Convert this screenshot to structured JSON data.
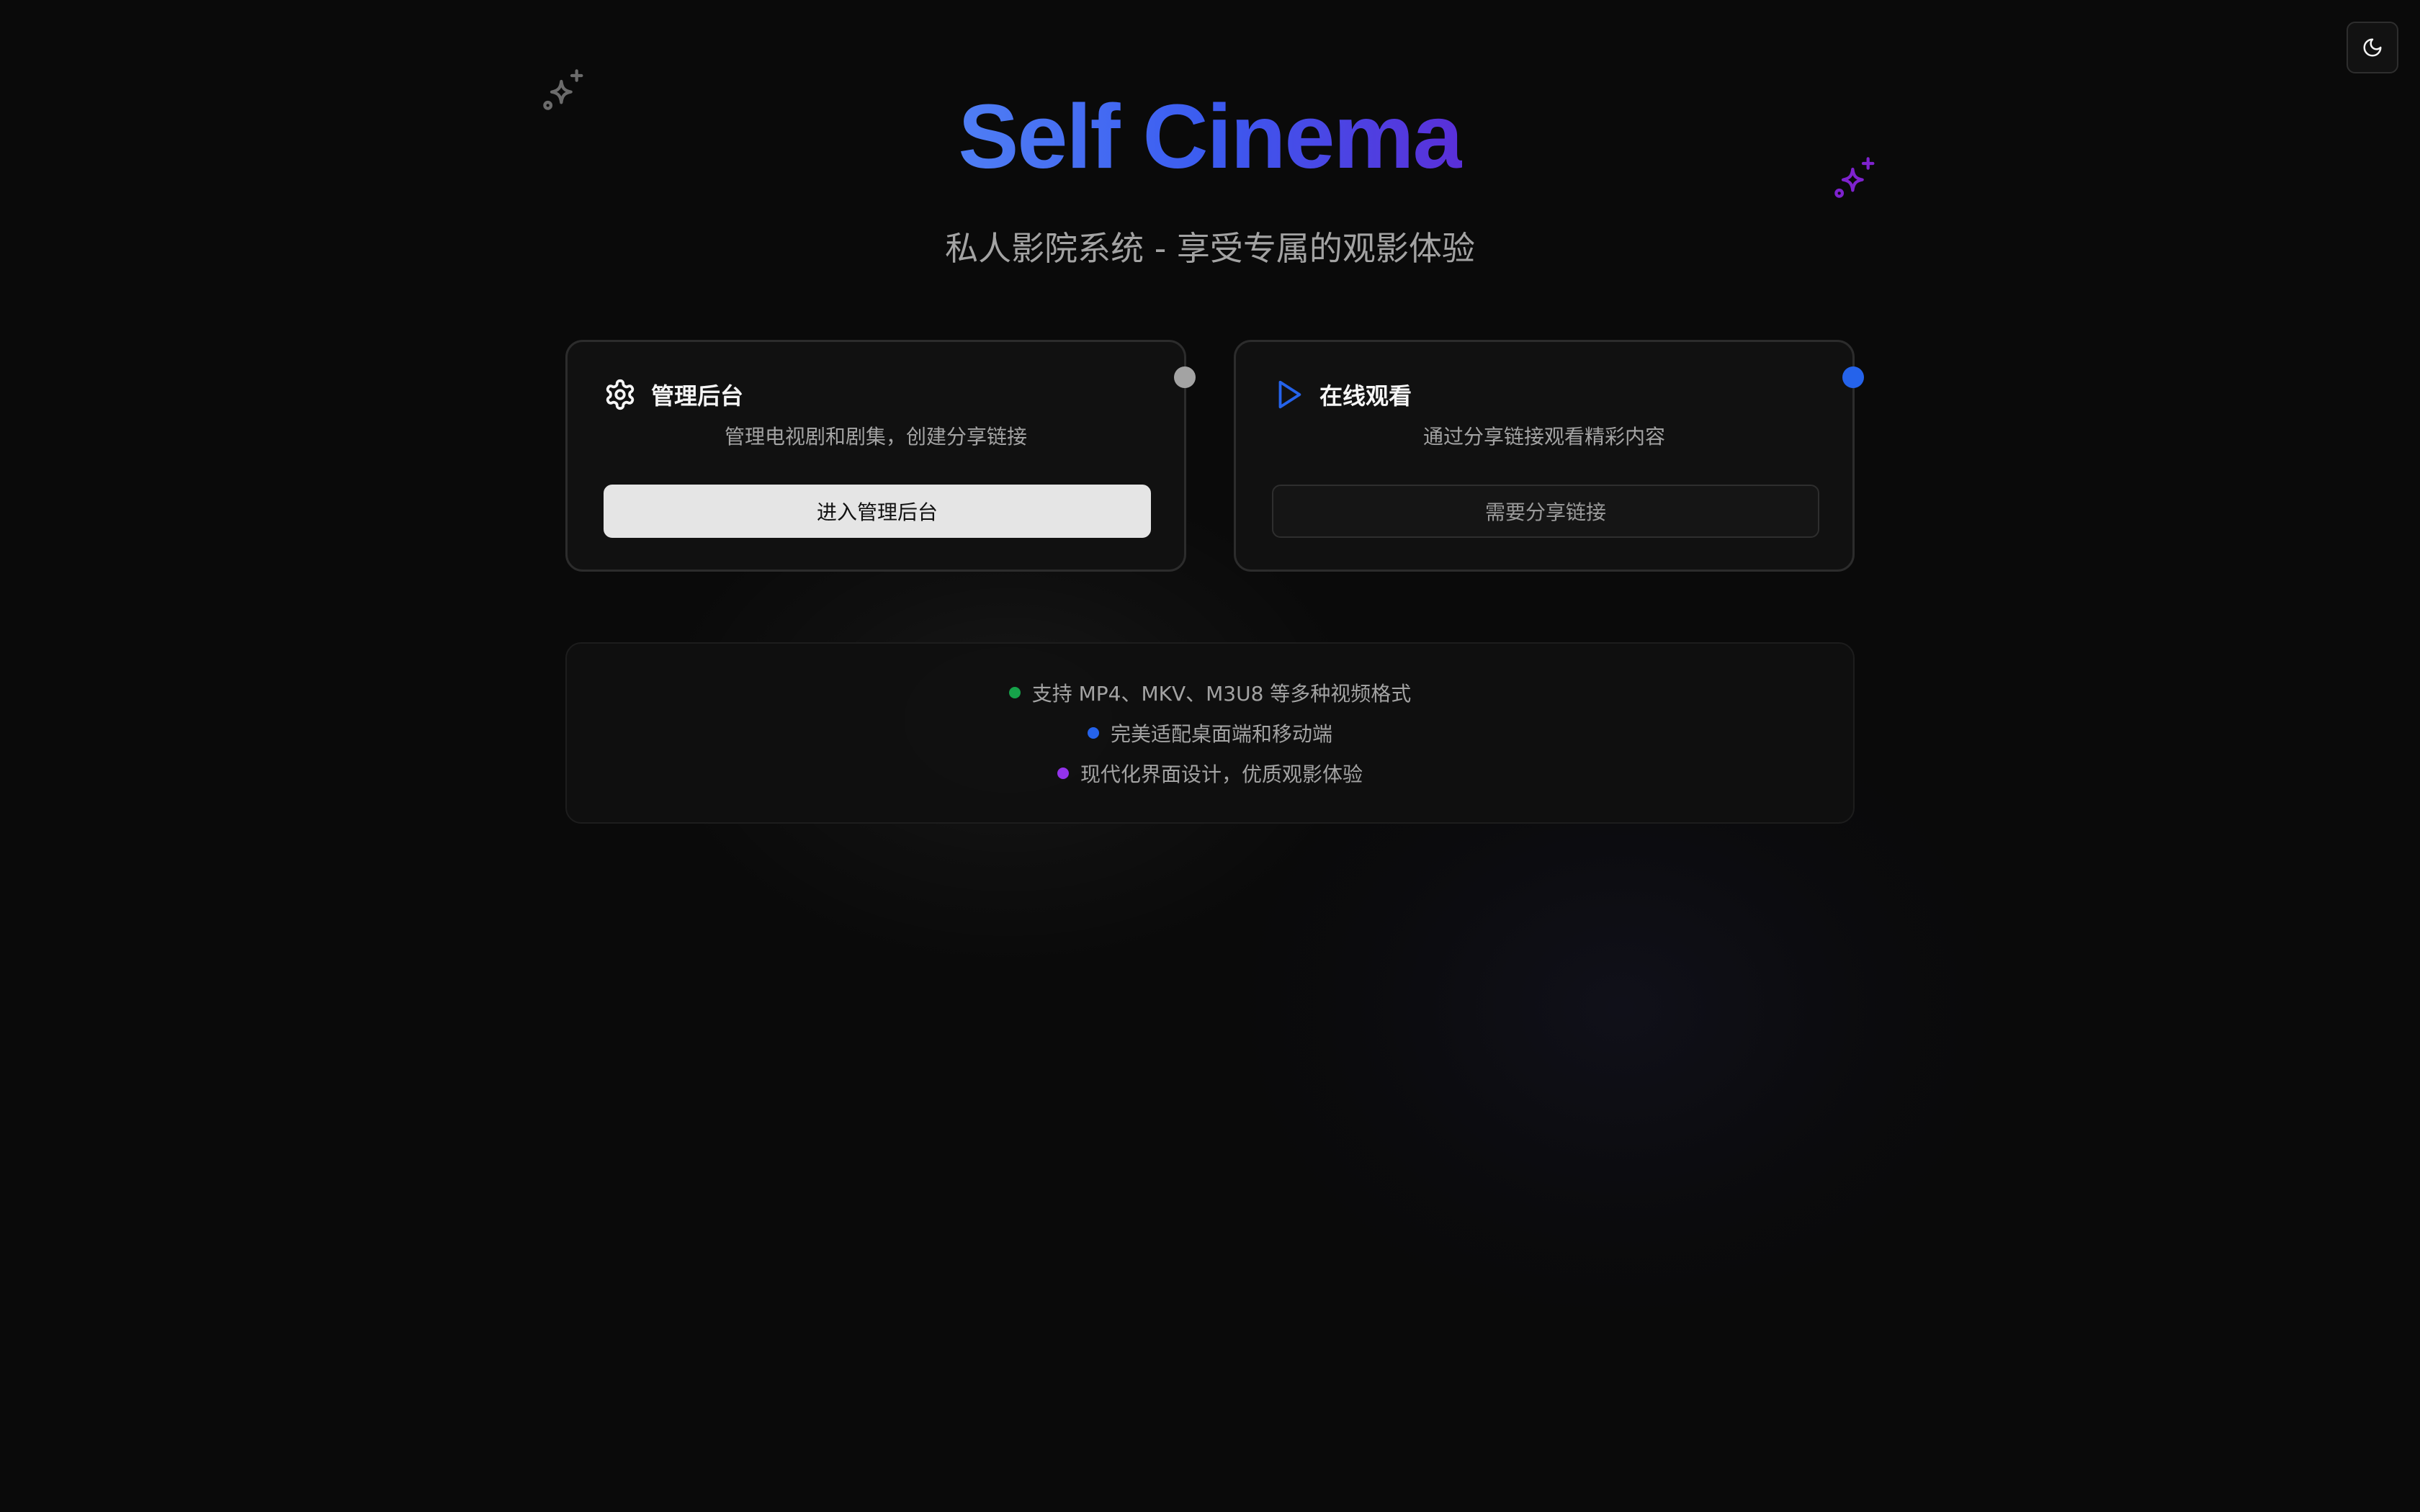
{
  "theme_toggle": {
    "icon": "moon-icon"
  },
  "hero": {
    "title": "Self Cinema",
    "subtitle": "私人影院系统 - 享受专属的观影体验",
    "title_gradient": [
      "#4f7ef4",
      "#3b5bf0",
      "#5a2fd8"
    ]
  },
  "decorations": {
    "left_sparkle": {
      "icon": "sparkles-icon",
      "color": "#6b6b6b"
    },
    "right_sparkle": {
      "icon": "sparkles-icon",
      "color": "#7e22ce"
    }
  },
  "cards": [
    {
      "icon": "gear-icon",
      "title": "管理后台",
      "description": "管理电视剧和剧集，创建分享链接",
      "button_label": "进入管理后台",
      "status_dot_color": "#a3a3a3"
    },
    {
      "icon": "play-icon",
      "title": "在线观看",
      "description": "通过分享链接观看精彩内容",
      "button_label": "需要分享链接",
      "status_dot_color": "#2563eb"
    }
  ],
  "features": [
    {
      "text": "支持 MP4、MKV、M3U8 等多种视频格式",
      "dot_color": "#16a34a"
    },
    {
      "text": "完美适配桌面端和移动端",
      "dot_color": "#2563eb"
    },
    {
      "text": "现代化界面设计，优质观影体验",
      "dot_color": "#9333ea"
    }
  ],
  "colors": {
    "background": "#0a0a0a",
    "card_background": "#111111",
    "accent_blue": "#2563eb"
  }
}
